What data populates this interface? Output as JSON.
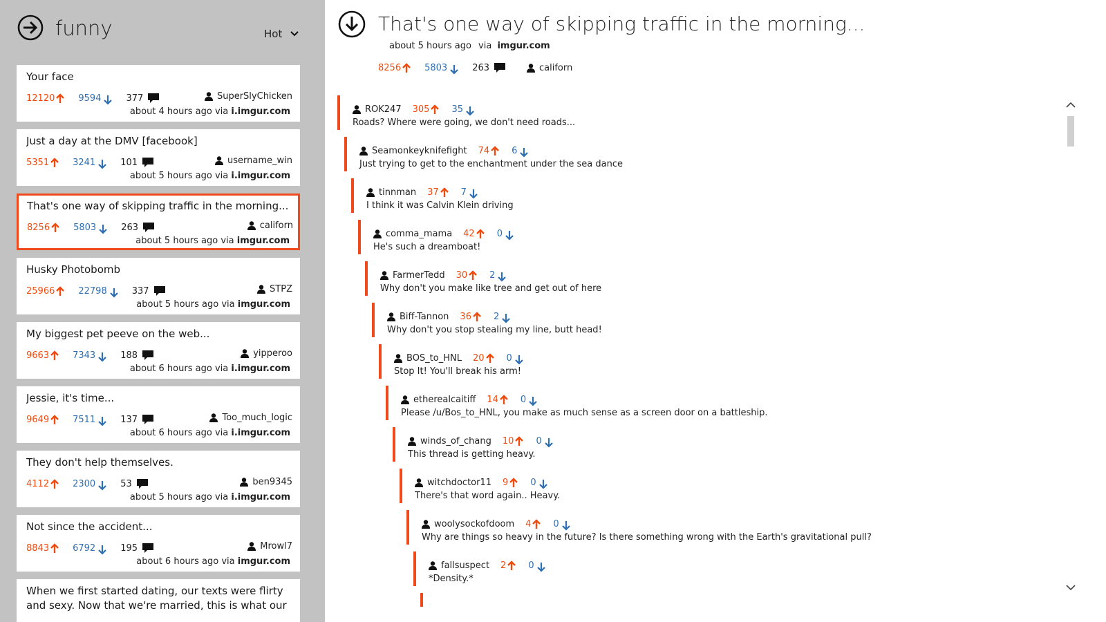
{
  "colors": {
    "accent": "#ee4a1c",
    "upvote": "#f04b0f",
    "downvote": "#2e6eb2",
    "sidebar_bg": "#c2c2c2"
  },
  "sidebar": {
    "subreddit": "funny",
    "sort_label": "Hot",
    "posts": [
      {
        "title": "Your face",
        "ups": "12120",
        "downs": "9594",
        "comments": "377",
        "author": "SuperSlyChicken",
        "time": "about 4 hours ago",
        "via": "via",
        "domain": "i.imgur.com"
      },
      {
        "title": "Just a day at the DMV [facebook]",
        "ups": "5351",
        "downs": "3241",
        "comments": "101",
        "author": "username_win",
        "time": "about 5 hours ago",
        "via": "via",
        "domain": "i.imgur.com"
      },
      {
        "title": "That's one way of skipping traffic in the morning...",
        "ups": "8256",
        "downs": "5803",
        "comments": "263",
        "author": "californ",
        "time": "about 5 hours ago",
        "via": "via",
        "domain": "imgur.com"
      },
      {
        "title": "Husky Photobomb",
        "ups": "25966",
        "downs": "22798",
        "comments": "337",
        "author": "STPZ",
        "time": "about 5 hours ago",
        "via": "via",
        "domain": "imgur.com"
      },
      {
        "title": "My biggest pet peeve on the web...",
        "ups": "9663",
        "downs": "7343",
        "comments": "188",
        "author": "yipperoo",
        "time": "about 6 hours ago",
        "via": "via",
        "domain": "i.imgur.com"
      },
      {
        "title": "Jessie, it's time...",
        "ups": "9649",
        "downs": "7511",
        "comments": "137",
        "author": "Too_much_logic",
        "time": "about 6 hours ago",
        "via": "via",
        "domain": "i.imgur.com"
      },
      {
        "title": "They don't help themselves.",
        "ups": "4112",
        "downs": "2300",
        "comments": "53",
        "author": "ben9345",
        "time": "about 5 hours ago",
        "via": "via",
        "domain": "i.imgur.com"
      },
      {
        "title": "Not since the accident...",
        "ups": "8843",
        "downs": "6792",
        "comments": "195",
        "author": "Mrowl7",
        "time": "about 6 hours ago",
        "via": "via",
        "domain": "imgur.com"
      },
      {
        "title": "When we first started dating, our texts were flirty and sexy. Now that we're married, this is what our texts"
      }
    ]
  },
  "detail": {
    "title": "That's one way of skipping traffic in the morning...",
    "time": "about 5 hours ago",
    "via": "via",
    "domain": "imgur.com",
    "ups": "8256",
    "downs": "5803",
    "comments": "263",
    "author": "californ"
  },
  "comments": [
    {
      "author": "ROK247",
      "ups": "305",
      "downs": "35",
      "text": "Roads? Where were going, we don't need roads..."
    },
    {
      "author": "Seamonkeyknifefight",
      "ups": "74",
      "downs": "6",
      "text": "Just trying to get to the enchantment under the sea dance"
    },
    {
      "author": "tinnman",
      "ups": "37",
      "downs": "7",
      "text": "I think it was Calvin Klein driving"
    },
    {
      "author": "comma_mama",
      "ups": "42",
      "downs": "0",
      "text": "He's such a dreamboat!"
    },
    {
      "author": "FarmerTedd",
      "ups": "30",
      "downs": "2",
      "text": "Why don't you make like tree and get out of here"
    },
    {
      "author": "Biff-Tannon",
      "ups": "36",
      "downs": "2",
      "text": "Why don't you stop stealing my line, butt head!"
    },
    {
      "author": "BOS_to_HNL",
      "ups": "20",
      "downs": "0",
      "text": "Stop It! You'll break his arm!"
    },
    {
      "author": "etherealcaitiff",
      "ups": "14",
      "downs": "0",
      "text": "Please /u/Bos_to_HNL, you make as much sense as a screen door on a battleship."
    },
    {
      "author": "winds_of_chang",
      "ups": "10",
      "downs": "0",
      "text": "This thread is getting heavy."
    },
    {
      "author": "witchdoctor11",
      "ups": "9",
      "downs": "0",
      "text": "There's that word again.. Heavy."
    },
    {
      "author": "woolysockofdoom",
      "ups": "4",
      "downs": "0",
      "text": "Why are things so heavy in the future? Is there something wrong with the Earth's gravitational pull?"
    },
    {
      "author": "fallsuspect",
      "ups": "2",
      "downs": "0",
      "text": "*Density.*"
    },
    {
      "author": "",
      "ups": "",
      "downs": "",
      "text": ""
    }
  ],
  "icons": {
    "back": "arrow-right-circle-icon",
    "collapse": "arrow-down-circle-icon",
    "sort": "chevron-down-icon",
    "upvote": "arrow-up-icon",
    "downvote": "arrow-down-icon",
    "comments": "speech-bubble-icon",
    "user": "user-icon"
  }
}
